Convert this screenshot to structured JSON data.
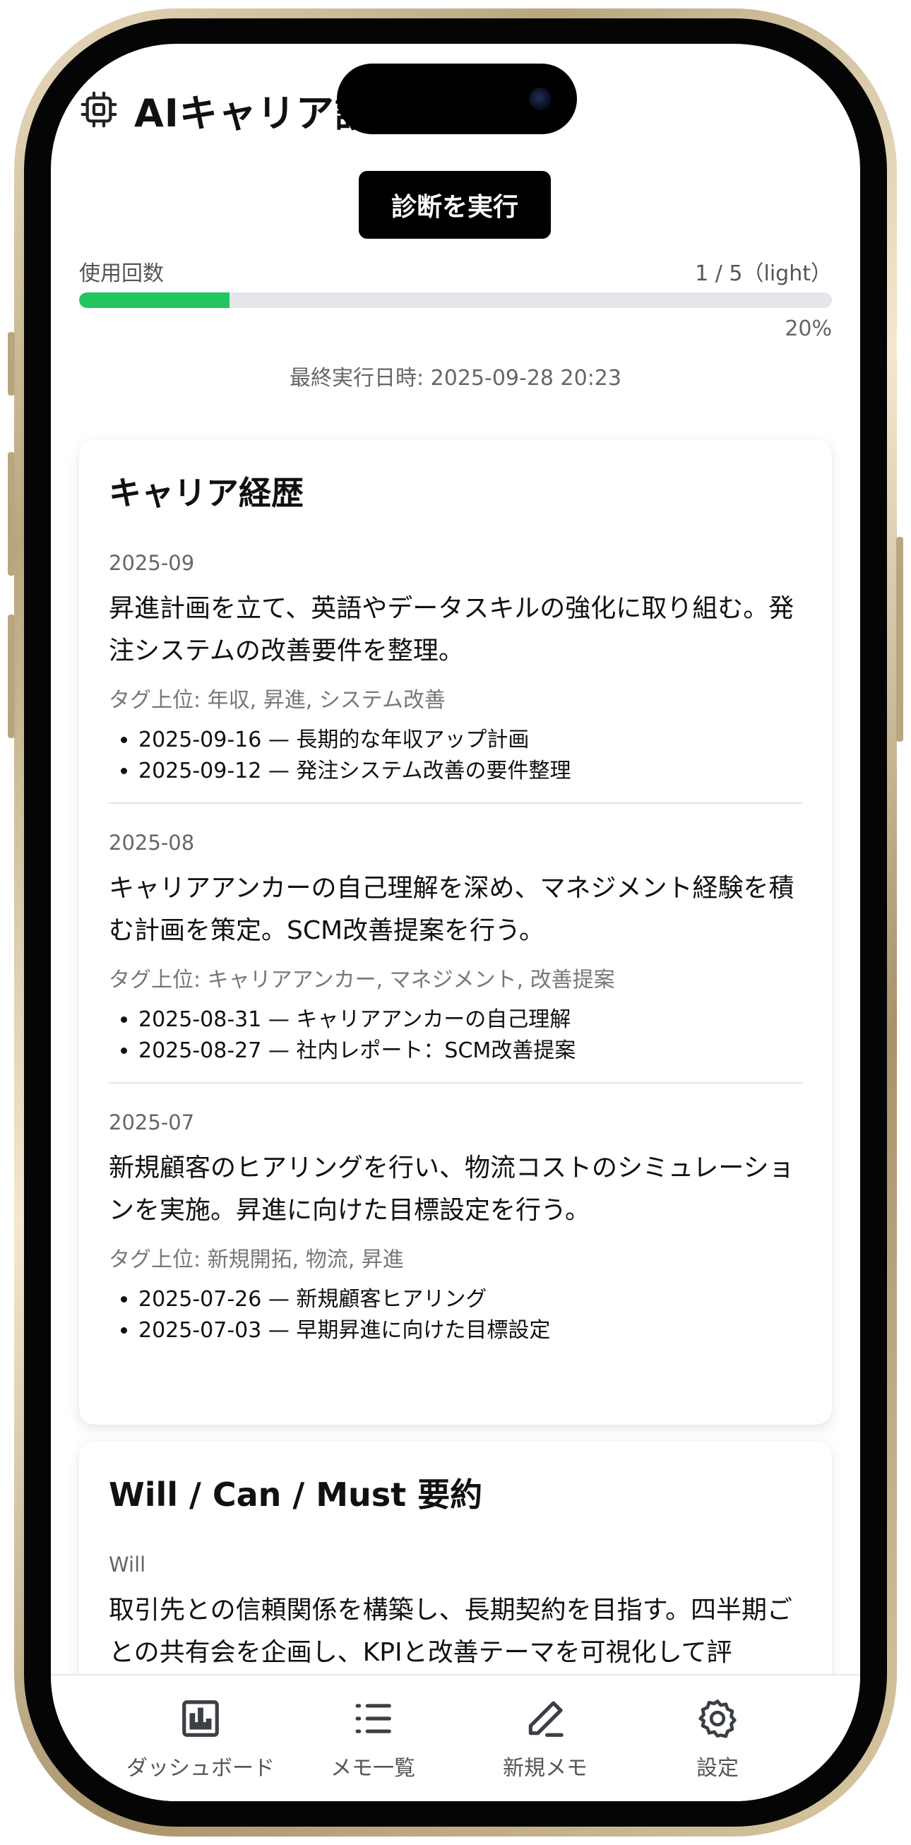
{
  "app": {
    "title": "AIキャリア診断"
  },
  "actions": {
    "run_label": "診断を実行"
  },
  "usage": {
    "label": "使用回数",
    "count": "1 / 5（light）",
    "percent_label": "20%",
    "progress_fraction": 0.2,
    "last_run": "最終実行日時: 2025-09-28 20:23"
  },
  "career": {
    "title": "キャリア経歴",
    "entries": [
      {
        "month": "2025-09",
        "text": "昇進計画を立て、英語やデータスキルの強化に取り組む。発注システムの改善要件を整理。",
        "tags": "タグ上位: 年収, 昇進, システム改善",
        "items": [
          "2025-09-16 — 長期的な年収アップ計画",
          "2025-09-12 — 発注システム改善の要件整理"
        ]
      },
      {
        "month": "2025-08",
        "text": "キャリアアンカーの自己理解を深め、マネジメント経験を積む計画を策定。SCM改善提案を行う。",
        "tags": "タグ上位: キャリアアンカー, マネジメント, 改善提案",
        "items": [
          "2025-08-31 — キャリアアンカーの自己理解",
          "2025-08-27 — 社内レポート：SCM改善提案"
        ]
      },
      {
        "month": "2025-07",
        "text": "新規顧客のヒアリングを行い、物流コストのシミュレーションを実施。昇進に向けた目標設定を行う。",
        "tags": "タグ上位: 新規開拓, 物流, 昇進",
        "items": [
          "2025-07-26 — 新規顧客ヒアリング",
          "2025-07-03 — 早期昇進に向けた目標設定"
        ]
      }
    ]
  },
  "wcm": {
    "title": "Will / Can / Must 要約",
    "will_label": "Will",
    "will_text": "取引先との信頼関係を構築し、長期契約を目指す。四半期ごとの共有会を企画し、KPIと改善テーマを可視化して評"
  },
  "nav": {
    "items": [
      {
        "label": "ダッシュボード",
        "icon": "dashboard-icon"
      },
      {
        "label": "メモ一覧",
        "icon": "list-icon"
      },
      {
        "label": "新規メモ",
        "icon": "pencil-icon"
      },
      {
        "label": "設定",
        "icon": "gear-icon"
      }
    ]
  },
  "colors": {
    "progress": "#22c55e",
    "button": "#000000"
  }
}
